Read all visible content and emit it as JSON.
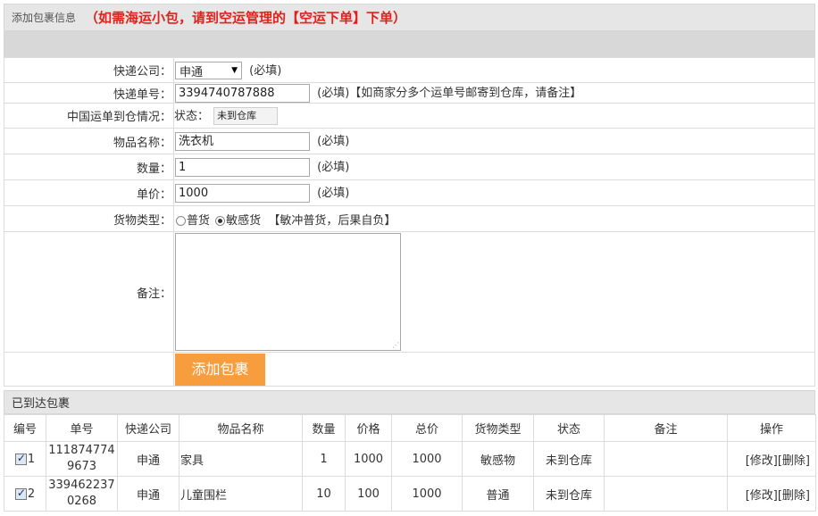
{
  "header": {
    "title": "添加包裹信息",
    "notice": "（如需海运小包，请到空运管理的【空运下单】下单）"
  },
  "form": {
    "courier": {
      "label": "快递公司：",
      "value": "申通",
      "note": "(必填)"
    },
    "tracking": {
      "label": "快递单号：",
      "value": "3394740787888",
      "note": "(必填)【如商家分多个运单号邮寄到仓库，请备注】"
    },
    "arrival": {
      "label": "中国运单到仓情况：",
      "status_label": "状态：",
      "status_value": "未到仓库"
    },
    "item_name": {
      "label": "物品名称：",
      "value": "洗衣机",
      "note": "(必填)"
    },
    "quantity": {
      "label": "数量：",
      "value": "1",
      "note": "(必填)"
    },
    "price": {
      "label": "单价：",
      "value": "1000",
      "note": "(必填)"
    },
    "cargo_type": {
      "label": "货物类型：",
      "option_normal": "普货",
      "option_sensitive": "敏感货",
      "selected": "敏感货",
      "note": "【敏冲普货，后果自负】"
    },
    "remark": {
      "label": "备注：",
      "value": ""
    },
    "submit_label": "添加包裹"
  },
  "arrived": {
    "title": "已到达包裹",
    "columns": [
      "编号",
      "单号",
      "快递公司",
      "物品名称",
      "数量",
      "价格",
      "总价",
      "货物类型",
      "状态",
      "备注",
      "操作"
    ],
    "rows": [
      {
        "id": "1",
        "tracking_l1": "111874774",
        "tracking_l2": "9673",
        "courier": "申通",
        "item": "家具",
        "qty": "1",
        "price": "1000",
        "total": "1000",
        "type": "敏感物",
        "status": "未到仓库",
        "remark": "",
        "edit": "[修改]",
        "delete": "[删除]"
      },
      {
        "id": "2",
        "tracking_l1": "339462237",
        "tracking_l2": "0268",
        "courier": "申通",
        "item": "儿童围栏",
        "qty": "10",
        "price": "100",
        "total": "1000",
        "type": "普通",
        "status": "未到仓库",
        "remark": "",
        "edit": "[修改]",
        "delete": "[删除]"
      }
    ]
  },
  "colors": {
    "notice": "#e3211c",
    "button": "#f89d3e",
    "header_bg": "#e6e6e6"
  }
}
